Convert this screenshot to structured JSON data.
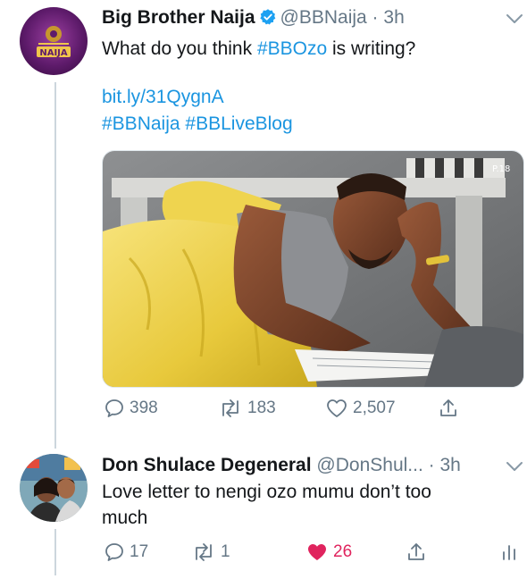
{
  "tweet": {
    "author_name": "Big Brother Naija",
    "author_handle": "@BBNaija",
    "time": "3h",
    "text_prefix": "What do you think ",
    "hashtag_main": "#BBOzo",
    "text_suffix": " is writing?",
    "link": "bit.ly/31QygnA",
    "hashtag_1": "#BBNaija",
    "hashtag_2": "#BBLiveBlog",
    "avatar_text": "NAIJA",
    "media_badge": "P.18",
    "replies": "398",
    "retweets": "183",
    "likes": "2,507"
  },
  "reply": {
    "author_name": "Don Shulace Degeneral",
    "author_handle": "@DonShul...",
    "time": "3h",
    "text_line1": "Love letter to nengi ozo mumu don’t too",
    "text_line2": "much",
    "replies": "17",
    "retweets": "1",
    "likes": "26"
  },
  "colors": {
    "link": "#1b95e0",
    "like_active": "#e0245e",
    "muted": "#657786"
  }
}
